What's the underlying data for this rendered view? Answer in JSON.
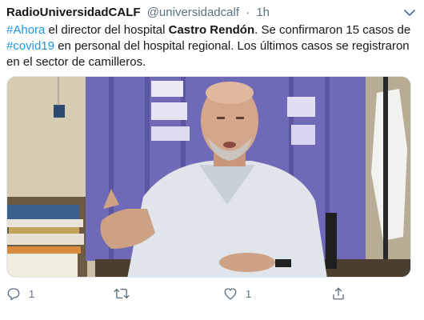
{
  "tweet": {
    "author_name": "RadioUniversidadCALF",
    "author_handle": "@universidadcalf",
    "separator": "·",
    "timestamp": "1h",
    "text": {
      "line1": [
        {
          "t": "#Ahora",
          "type": "hashtag"
        },
        {
          "t": " el director del hospital ",
          "type": "text"
        },
        {
          "t": "Castro Rendón",
          "type": "bold"
        },
        {
          "t": ". Se confirmaron 15 casos de",
          "type": "text"
        }
      ],
      "line2": [
        {
          "t": "#covid19",
          "type": "hashtag"
        },
        {
          "t": " en personal del hospital regional. Los últimos casos se registraron",
          "type": "text"
        }
      ],
      "line3": [
        {
          "t": "en el sector de camilleros.",
          "type": "text"
        }
      ]
    },
    "media": {
      "kind": "photo",
      "description_icon": "photo-man-seated-at-desk"
    },
    "actions": {
      "reply": {
        "icon": "reply-icon",
        "count": "1"
      },
      "retweet": {
        "icon": "retweet-icon",
        "count": ""
      },
      "like": {
        "icon": "heart-icon",
        "count": "1"
      },
      "share": {
        "icon": "share-icon",
        "count": ""
      }
    }
  },
  "colors": {
    "link": "#1b95e0",
    "secondary_text": "#5b7083",
    "primary_text": "#14171a",
    "curtain": "#6f6ab8"
  }
}
